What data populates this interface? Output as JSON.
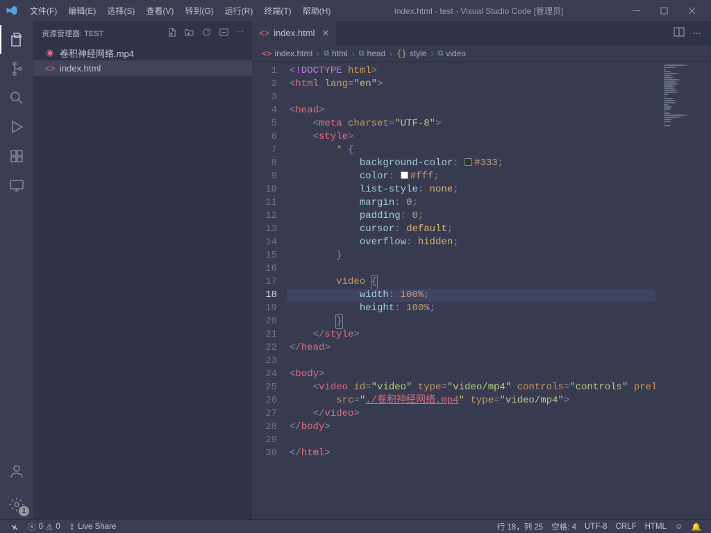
{
  "titlebar": {
    "menus": [
      "文件(F)",
      "编辑(E)",
      "选择(S)",
      "查看(V)",
      "转到(G)",
      "运行(R)",
      "终端(T)",
      "帮助(H)"
    ],
    "title": "index.html - test - Visual Studio Code [管理员]"
  },
  "activitybar": {
    "badge": "1"
  },
  "sidebar": {
    "header": "资源管理器: TEST",
    "files": [
      {
        "name": "卷积神经网络.mp4",
        "type": "mp4"
      },
      {
        "name": "index.html",
        "type": "html",
        "active": true
      }
    ]
  },
  "tabs": [
    {
      "name": "index.html"
    }
  ],
  "breadcrumbs": [
    "index.html",
    "html",
    "head",
    "style",
    "video"
  ],
  "code": {
    "current_line": 18,
    "lines": [
      {
        "n": 1,
        "tokens": [
          [
            "c-punc",
            "<"
          ],
          [
            "c-special",
            "!DOCTYPE "
          ],
          [
            "c-attr",
            "html"
          ],
          [
            "c-punc",
            ">"
          ]
        ]
      },
      {
        "n": 2,
        "tokens": [
          [
            "c-punc",
            "<"
          ],
          [
            "c-tag",
            "html "
          ],
          [
            "c-attr",
            "lang"
          ],
          [
            "c-punc",
            "="
          ],
          [
            "c-str",
            "\"en\""
          ],
          [
            "c-punc",
            ">"
          ]
        ]
      },
      {
        "n": 3,
        "tokens": []
      },
      {
        "n": 4,
        "tokens": [
          [
            "c-punc",
            "<"
          ],
          [
            "c-tag",
            "head"
          ],
          [
            "c-punc",
            ">"
          ]
        ]
      },
      {
        "n": 5,
        "indent": 2,
        "tokens": [
          [
            "c-punc",
            "<"
          ],
          [
            "c-tag",
            "meta "
          ],
          [
            "c-attr",
            "charset"
          ],
          [
            "c-punc",
            "="
          ],
          [
            "c-str",
            "\"UTF-8\""
          ],
          [
            "c-punc",
            ">"
          ]
        ]
      },
      {
        "n": 6,
        "indent": 2,
        "tokens": [
          [
            "c-punc",
            "<"
          ],
          [
            "c-tag",
            "style"
          ],
          [
            "c-punc",
            ">"
          ]
        ]
      },
      {
        "n": 7,
        "indent": 4,
        "tokens": [
          [
            "c-sel",
            "* "
          ],
          [
            "c-punc",
            "{"
          ]
        ]
      },
      {
        "n": 8,
        "indent": 6,
        "tokens": [
          [
            "c-prop",
            "background-color"
          ],
          [
            "c-punc",
            ": "
          ],
          [
            "colorbox",
            "#333333"
          ],
          [
            "c-num",
            "#333"
          ],
          [
            "c-punc",
            ";"
          ]
        ]
      },
      {
        "n": 9,
        "indent": 6,
        "tokens": [
          [
            "c-prop",
            "color"
          ],
          [
            "c-punc",
            ": "
          ],
          [
            "colorbox",
            "#ffffff"
          ],
          [
            "c-num",
            "#fff"
          ],
          [
            "c-punc",
            ";"
          ]
        ]
      },
      {
        "n": 10,
        "indent": 6,
        "tokens": [
          [
            "c-prop",
            "list-style"
          ],
          [
            "c-punc",
            ": "
          ],
          [
            "c-val",
            "none"
          ],
          [
            "c-punc",
            ";"
          ]
        ]
      },
      {
        "n": 11,
        "indent": 6,
        "tokens": [
          [
            "c-prop",
            "margin"
          ],
          [
            "c-punc",
            ": "
          ],
          [
            "c-num",
            "0"
          ],
          [
            "c-punc",
            ";"
          ]
        ]
      },
      {
        "n": 12,
        "indent": 6,
        "tokens": [
          [
            "c-prop",
            "padding"
          ],
          [
            "c-punc",
            ": "
          ],
          [
            "c-num",
            "0"
          ],
          [
            "c-punc",
            ";"
          ]
        ]
      },
      {
        "n": 13,
        "indent": 6,
        "tokens": [
          [
            "c-prop",
            "cursor"
          ],
          [
            "c-punc",
            ": "
          ],
          [
            "c-val",
            "default"
          ],
          [
            "c-punc",
            ";"
          ]
        ]
      },
      {
        "n": 14,
        "indent": 6,
        "tokens": [
          [
            "c-prop",
            "overflow"
          ],
          [
            "c-punc",
            ": "
          ],
          [
            "c-val",
            "hidden"
          ],
          [
            "c-punc",
            ";"
          ]
        ]
      },
      {
        "n": 15,
        "indent": 4,
        "tokens": [
          [
            "c-punc",
            "}"
          ]
        ]
      },
      {
        "n": 16,
        "tokens": []
      },
      {
        "n": 17,
        "indent": 4,
        "tokens": [
          [
            "c-sel",
            "video "
          ],
          [
            "openbrace",
            "{"
          ]
        ]
      },
      {
        "n": 18,
        "indent": 6,
        "hl": true,
        "tokens": [
          [
            "c-prop",
            "width"
          ],
          [
            "c-punc",
            ": "
          ],
          [
            "c-num",
            "100%"
          ],
          [
            "c-punc",
            ";"
          ]
        ]
      },
      {
        "n": 19,
        "indent": 6,
        "tokens": [
          [
            "c-prop",
            "height"
          ],
          [
            "c-punc",
            ": "
          ],
          [
            "c-num",
            "100%"
          ],
          [
            "c-punc",
            ";"
          ]
        ]
      },
      {
        "n": 20,
        "indent": 4,
        "tokens": [
          [
            "closebrace",
            "}"
          ]
        ]
      },
      {
        "n": 21,
        "indent": 2,
        "tokens": [
          [
            "c-punc",
            "</"
          ],
          [
            "c-tag",
            "style"
          ],
          [
            "c-punc",
            ">"
          ]
        ]
      },
      {
        "n": 22,
        "tokens": [
          [
            "c-punc",
            "</"
          ],
          [
            "c-tag",
            "head"
          ],
          [
            "c-punc",
            ">"
          ]
        ]
      },
      {
        "n": 23,
        "tokens": []
      },
      {
        "n": 24,
        "tokens": [
          [
            "c-punc",
            "<"
          ],
          [
            "c-tag",
            "body"
          ],
          [
            "c-punc",
            ">"
          ]
        ]
      },
      {
        "n": 25,
        "indent": 2,
        "tokens": [
          [
            "c-punc",
            "<"
          ],
          [
            "c-tag",
            "video "
          ],
          [
            "c-attr",
            "id"
          ],
          [
            "c-punc",
            "="
          ],
          [
            "c-str",
            "\"video\" "
          ],
          [
            "c-attr",
            "type"
          ],
          [
            "c-punc",
            "="
          ],
          [
            "c-str",
            "\"video/mp4\" "
          ],
          [
            "c-attr",
            "controls"
          ],
          [
            "c-punc",
            "="
          ],
          [
            "c-str",
            "\"controls\" "
          ],
          [
            "c-attr",
            "preload"
          ]
        ]
      },
      {
        "n": 26,
        "indent": 4,
        "tokens": [
          [
            "c-attr",
            "src"
          ],
          [
            "c-punc",
            "="
          ],
          [
            "c-str",
            "\""
          ],
          [
            "c-link",
            "./卷积神经网络.mp4"
          ],
          [
            "c-str",
            "\" "
          ],
          [
            "c-attr",
            "type"
          ],
          [
            "c-punc",
            "="
          ],
          [
            "c-str",
            "\"video/mp4\""
          ],
          [
            "c-punc",
            ">"
          ]
        ]
      },
      {
        "n": 27,
        "indent": 2,
        "tokens": [
          [
            "c-punc",
            "</"
          ],
          [
            "c-tag",
            "video"
          ],
          [
            "c-punc",
            ">"
          ]
        ]
      },
      {
        "n": 28,
        "tokens": [
          [
            "c-punc",
            "</"
          ],
          [
            "c-tag",
            "body"
          ],
          [
            "c-punc",
            ">"
          ]
        ]
      },
      {
        "n": 29,
        "tokens": []
      },
      {
        "n": 30,
        "tokens": [
          [
            "c-punc",
            "</"
          ],
          [
            "c-tag",
            "html"
          ],
          [
            "c-punc",
            ">"
          ]
        ]
      }
    ]
  },
  "statusbar": {
    "errors": "0",
    "warnings": "0",
    "liveshare": "Live Share",
    "position": "行 18，列 25",
    "spaces": "空格: 4",
    "encoding": "UTF-8",
    "eol": "CRLF",
    "lang": "HTML"
  }
}
